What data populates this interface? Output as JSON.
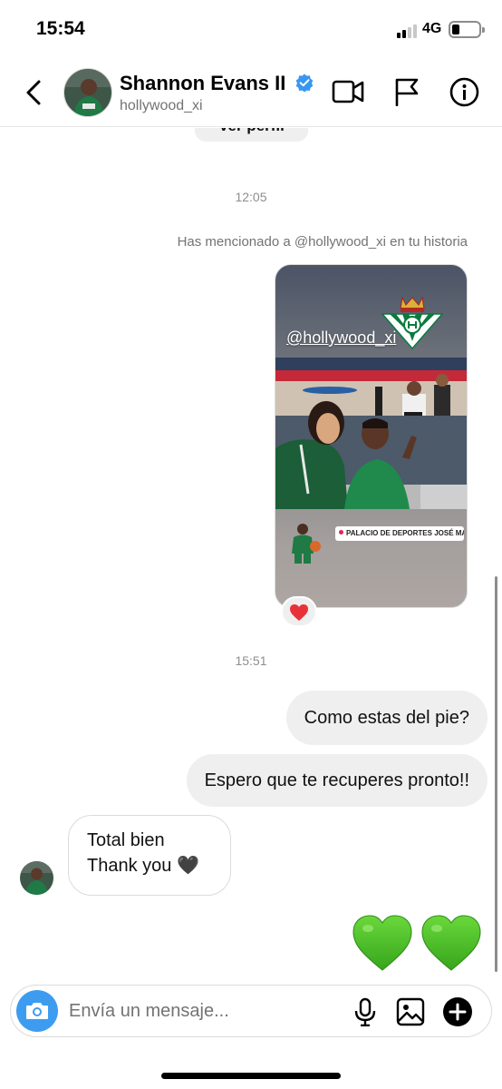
{
  "status_bar": {
    "time": "15:54",
    "network": "4G"
  },
  "header": {
    "name": "Shannon Evans II",
    "username": "hollywood_xi"
  },
  "chat": {
    "profile_button": "Ver perfil",
    "timestamp_1": "12:05",
    "mention_notice": "Has mencionado a @hollywood_xi en tu historia",
    "story": {
      "mention_sticker": "@hollywood_xi",
      "location": "PALACIO DE DEPORTES JOSÉ MARÍA MARTÍ...",
      "reaction": "❤️"
    },
    "timestamp_2": "15:51",
    "messages": [
      {
        "direction": "out",
        "text": "Como estas del pie?"
      },
      {
        "direction": "out",
        "text": "Espero que te recuperes pronto!!"
      },
      {
        "direction": "in",
        "line1": "Total bien",
        "line2": "Thank you 🖤"
      }
    ],
    "last_reaction": "💚💚"
  },
  "composer": {
    "placeholder": "Envía un mensaje..."
  },
  "colors": {
    "verified": "#3897f0",
    "camera_button": "#3d9cf0",
    "heart_green": "#4fbf26"
  }
}
